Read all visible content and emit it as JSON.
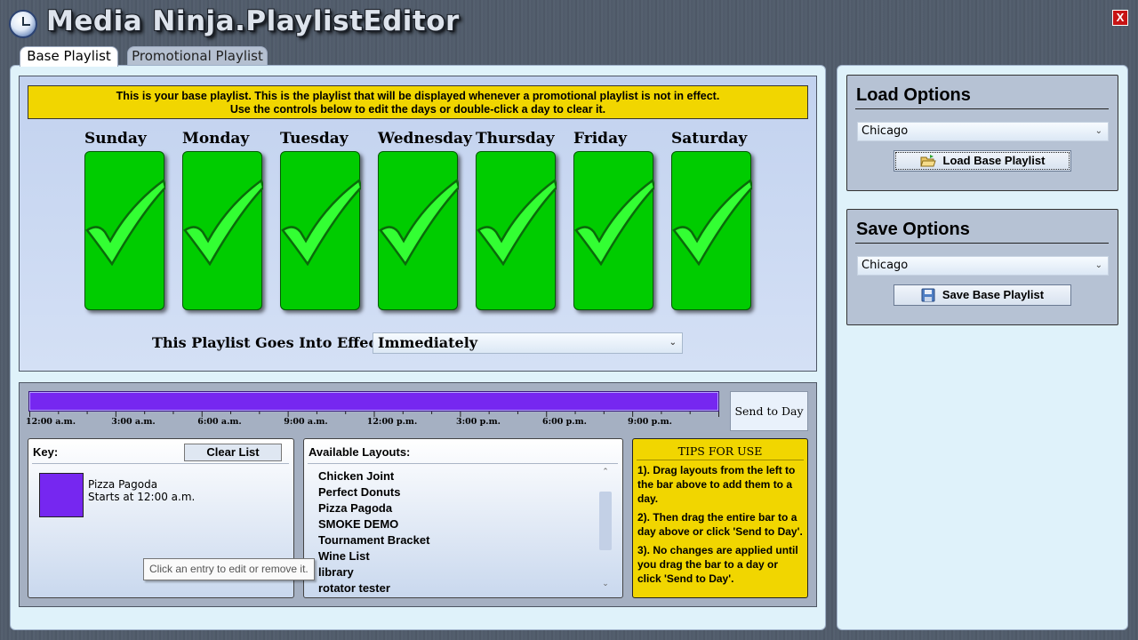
{
  "app": {
    "title": "Media Ninja.PlaylistEditor",
    "close_label": "X"
  },
  "tabs": [
    {
      "label": "Base Playlist",
      "selected": true
    },
    {
      "label": "Promotional Playlist",
      "selected": false
    }
  ],
  "notice": {
    "line1": "This is your base playlist. This is the playlist that will be displayed whenever a promotional playlist is not in effect.",
    "line2": "Use the controls below to edit the days or double-click a day to clear it."
  },
  "days": [
    {
      "label": "Sunday",
      "checked": true
    },
    {
      "label": "Monday",
      "checked": true
    },
    {
      "label": "Tuesday",
      "checked": true
    },
    {
      "label": "Wednesday",
      "checked": true
    },
    {
      "label": "Thursday",
      "checked": true
    },
    {
      "label": "Friday",
      "checked": true
    },
    {
      "label": "Saturday",
      "checked": true
    }
  ],
  "effect": {
    "label": "This Playlist Goes Into Effect:",
    "value": "Immediately"
  },
  "timeline": {
    "tick_labels": [
      "12:00 a.m.",
      "3:00 a.m.",
      "6:00 a.m.",
      "9:00 a.m.",
      "12:00 p.m.",
      "3:00 p.m.",
      "6:00 p.m.",
      "9:00 p.m."
    ],
    "send_label": "Send to Day",
    "bar_color": "#7627f0"
  },
  "key": {
    "label": "Key:",
    "clear_label": "Clear List",
    "entries": [
      {
        "name": "Pizza Pagoda",
        "start": "Starts at 12:00 a.m.",
        "color": "#7627f0"
      }
    ],
    "tooltip": "Click an entry to edit or remove it."
  },
  "layouts": {
    "label": "Available Layouts:",
    "items": [
      "Chicken Joint",
      "Perfect Donuts",
      "Pizza Pagoda",
      "SMOKE DEMO",
      "Tournament Bracket",
      "Wine List",
      "library",
      "rotator tester"
    ]
  },
  "tips": {
    "title": "TIPS FOR USE",
    "items": [
      "1). Drag layouts from the left to the bar above to add them to a day.",
      "2). Then drag the entire bar to a day above or click 'Send to Day'.",
      "3). No changes are applied until you drag the bar to a day or click 'Send to Day'."
    ]
  },
  "load_options": {
    "title": "Load Options",
    "location": "Chicago",
    "button_label": "Load Base Playlist",
    "icon": "folder-icon"
  },
  "save_options": {
    "title": "Save Options",
    "location": "Chicago",
    "button_label": "Save Base Playlist",
    "icon": "floppy-disk-icon"
  },
  "colors": {
    "day_enabled": "#00cc00",
    "notice_bg": "#f1d600",
    "tips_bg": "#f1d600"
  }
}
